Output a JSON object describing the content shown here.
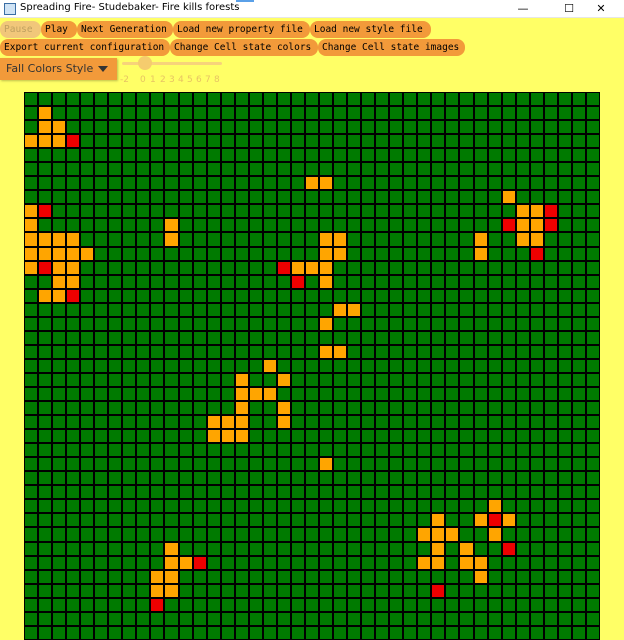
{
  "window": {
    "title": "Spreading Fire- Studebaker- Fire kills forests",
    "controls": [
      "minimize-icon",
      "maximize-icon",
      "close-icon"
    ]
  },
  "toolbar": {
    "row1": [
      "Pause",
      "Play",
      "Next Generation",
      "Load new property file",
      "Load new style file"
    ],
    "row2": [
      "Export current configuration",
      "Change Cell state colors",
      "Change Cell state images"
    ]
  },
  "style_select": {
    "value": "Fall Colors Style"
  },
  "slider": {
    "value": 0,
    "tick_labels": [
      "-2",
      "0",
      "1",
      "2",
      "3",
      "4",
      "5",
      "6",
      "7",
      "8"
    ]
  },
  "grid": {
    "columns": 41,
    "visible_rows": 39,
    "states": {
      "0": "tree",
      "1": "burning",
      "2": "empty"
    },
    "colors": {
      "tree": "#007a00",
      "burning": "#ffa500",
      "empty": "#ee0000"
    },
    "cells": [
      "00000000000000000000000000000000000000000",
      "01000000000000000000000000000000000000000",
      "01100000000000000000000000000000000000000",
      "11120000000000000000000000000000000000000",
      "00000000000000000000000000000000000000000",
      "00000000000000000000000000000000000000000",
      "00000000000000000000110000000000000000000",
      "00000000000000000000000000000000001000000",
      "12000000000000000000000000000000000112000",
      "10000000001000000000000000000000002112000",
      "11110000001000000000011000000000100110000",
      "11111000000000000000011000000000100020000",
      "12110000000000000021110000000000000000000",
      "00110000000000000002010000000000000000000",
      "01120000000000000000000000000000000000000",
      "00000000000000000000001100000000000000000",
      "00000000000000000000010000000000000000000",
      "00000000000000000000000000000000000000000",
      "00000000000000000000011000000000000000000",
      "00000000000000000100000000000000000000000",
      "00000000000000010010000000000000000000000",
      "00000000000000011100000000000000000000000",
      "00000000000000010010000000000000000000000",
      "00000000000001110010000000000000000000000",
      "00000000000001110000000000000000000000000",
      "00000000000000000000000000000000000000000",
      "00000000000000000000010000000000000000000",
      "00000000000000000000000000000000000000000",
      "00000000000000000000000000000000000000000",
      "00000000000000000000000000000000010000000",
      "00000000000000000000000000000100121000000",
      "00000000000000000000000000001110010000000",
      "00000000001000000000000000000101002000000",
      "00000000001120000000000000001101100000000",
      "00000000011000000000000000000000100000000",
      "00000000011000000000000000000200000000000",
      "00000000020000000000000000000000000000000",
      "00000000000000000000000000000000000000000",
      "00000000000000000000000000000000000000000"
    ]
  }
}
